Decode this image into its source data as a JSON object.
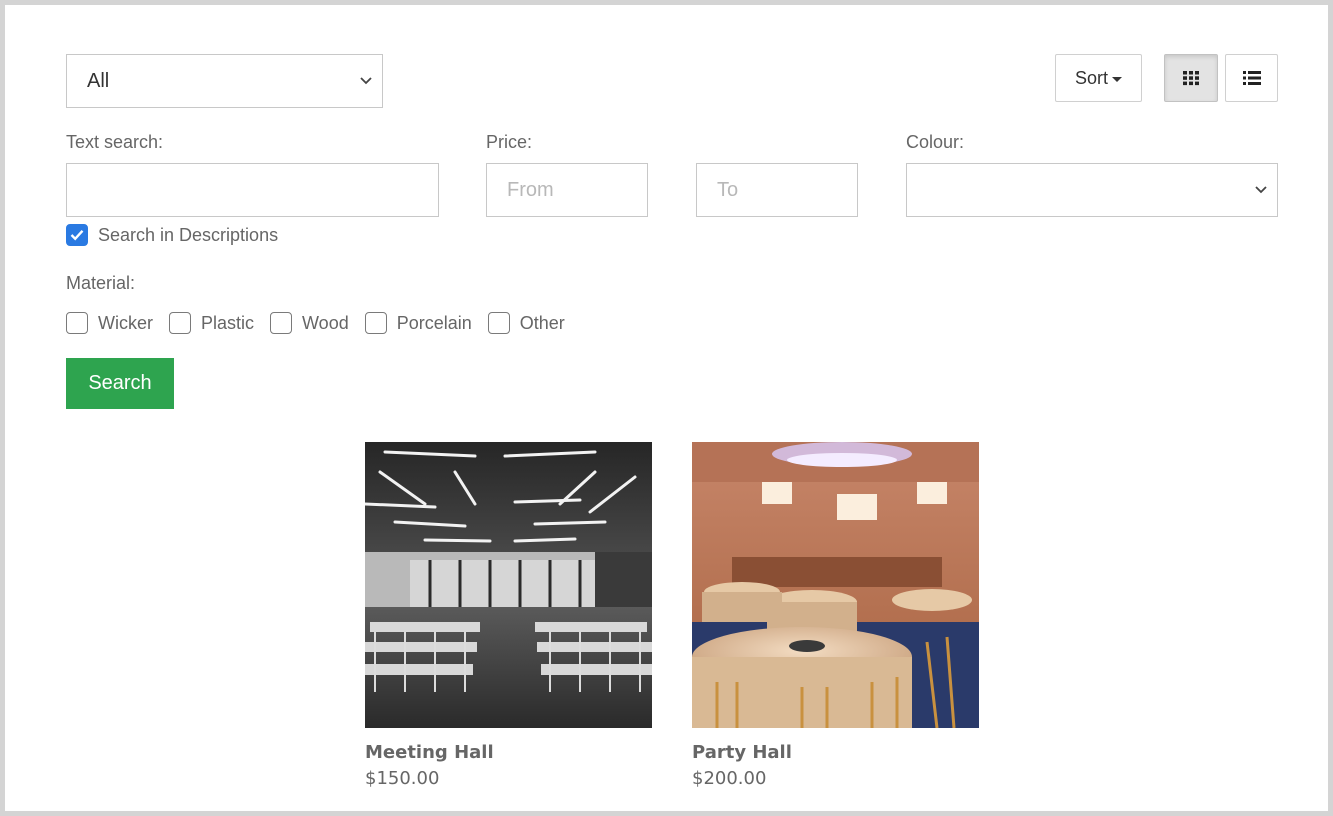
{
  "filters": {
    "category": {
      "selected": "All"
    },
    "sort_label": "Sort",
    "text_search": {
      "label": "Text search:",
      "value": "",
      "placeholder": ""
    },
    "search_descriptions": {
      "label": "Search in Descriptions",
      "checked": true
    },
    "price": {
      "label": "Price:",
      "from_placeholder": "From",
      "to_placeholder": "To"
    },
    "colour": {
      "label": "Colour:",
      "selected": ""
    },
    "material": {
      "label": "Material:",
      "options": [
        {
          "label": "Wicker",
          "checked": false
        },
        {
          "label": "Plastic",
          "checked": false
        },
        {
          "label": "Wood",
          "checked": false
        },
        {
          "label": "Porcelain",
          "checked": false
        },
        {
          "label": "Other",
          "checked": false
        }
      ]
    },
    "search_button": "Search"
  },
  "view": {
    "active": "grid"
  },
  "products": [
    {
      "name": "Meeting Hall",
      "price": "$150.00"
    },
    {
      "name": "Party Hall",
      "price": "$200.00"
    }
  ],
  "colors": {
    "search_button": "#2ea44f",
    "checkbox_checked": "#2a7ae2"
  }
}
